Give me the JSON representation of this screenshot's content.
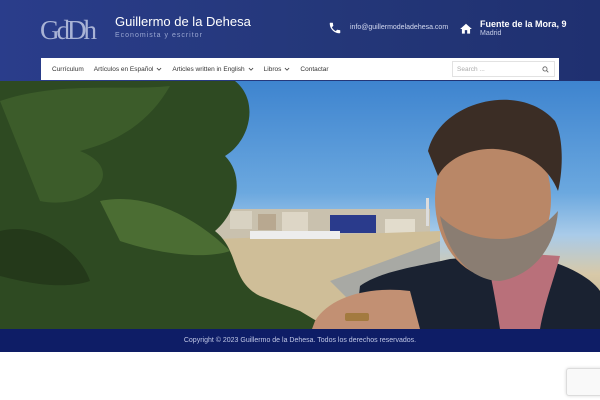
{
  "header": {
    "logo_text": "GdDh",
    "site_title": "Guillermo de la Dehesa",
    "site_tagline": "Economista y escritor",
    "email": "info@guillermodeladehesa.com",
    "address_line1": "Fuente de la Mora, 9",
    "address_line2": "Madrid",
    "colors": {
      "background": "#243779",
      "logo": "#a9b3d5",
      "accent": "#ffffff"
    }
  },
  "nav": {
    "items": [
      {
        "label": "Currículum",
        "has_dropdown": false
      },
      {
        "label": "Artículos en Español",
        "has_dropdown": true
      },
      {
        "label": "Articles written in English",
        "has_dropdown": true
      },
      {
        "label": "Libros",
        "has_dropdown": true
      },
      {
        "label": "Contactar",
        "has_dropdown": false
      }
    ],
    "search_placeholder": "Search ..."
  },
  "icons": {
    "phone": "phone-icon",
    "home": "home-icon",
    "search": "search-icon",
    "dropdown": "chevron-down-icon"
  },
  "footer": {
    "copyright": "Copyright © 2023 Guillermo de la Dehesa. Todos los derechos reservados.",
    "background": "#0e1d66"
  }
}
